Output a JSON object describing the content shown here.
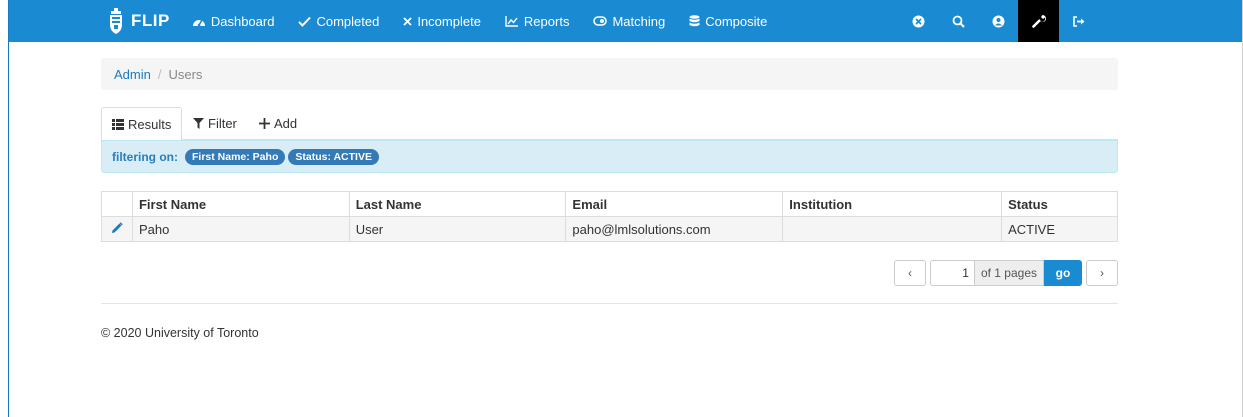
{
  "navbar": {
    "brand": "FLIP",
    "items": [
      {
        "label": "Dashboard",
        "icon": "dashboard-icon"
      },
      {
        "label": "Completed",
        "icon": "check-icon"
      },
      {
        "label": "Incomplete",
        "icon": "x-icon"
      },
      {
        "label": "Reports",
        "icon": "chart-icon"
      },
      {
        "label": "Matching",
        "icon": "link-icon"
      },
      {
        "label": "Composite",
        "icon": "database-icon"
      }
    ],
    "right_icons": [
      "close-circle-icon",
      "search-icon",
      "user-icon",
      "wrench-icon",
      "sign-out-icon"
    ],
    "colors": {
      "bar": "#1a8bd2",
      "active": "#000000"
    }
  },
  "breadcrumb": {
    "parent": "Admin",
    "separator": "/",
    "current": "Users"
  },
  "tabs": [
    {
      "label": "Results",
      "icon": "list-icon",
      "active": true
    },
    {
      "label": "Filter",
      "icon": "filter-icon",
      "active": false
    },
    {
      "label": "Add",
      "icon": "plus-icon",
      "active": false
    }
  ],
  "filter": {
    "label": "filtering on:",
    "badges": [
      "First Name: Paho",
      "Status: ACTIVE"
    ]
  },
  "table": {
    "columns": [
      "First Name",
      "Last Name",
      "Email",
      "Institution",
      "Status"
    ],
    "rows": [
      {
        "first_name": "Paho",
        "last_name": "User",
        "email": "paho@lmlsolutions.com",
        "institution": "",
        "status": "ACTIVE"
      }
    ]
  },
  "pagination": {
    "current_page": "1",
    "of_text": "of 1 pages",
    "go_label": "go",
    "prev": "‹",
    "next": "›"
  },
  "footer": {
    "copyright": "© 2020 University of Toronto"
  }
}
